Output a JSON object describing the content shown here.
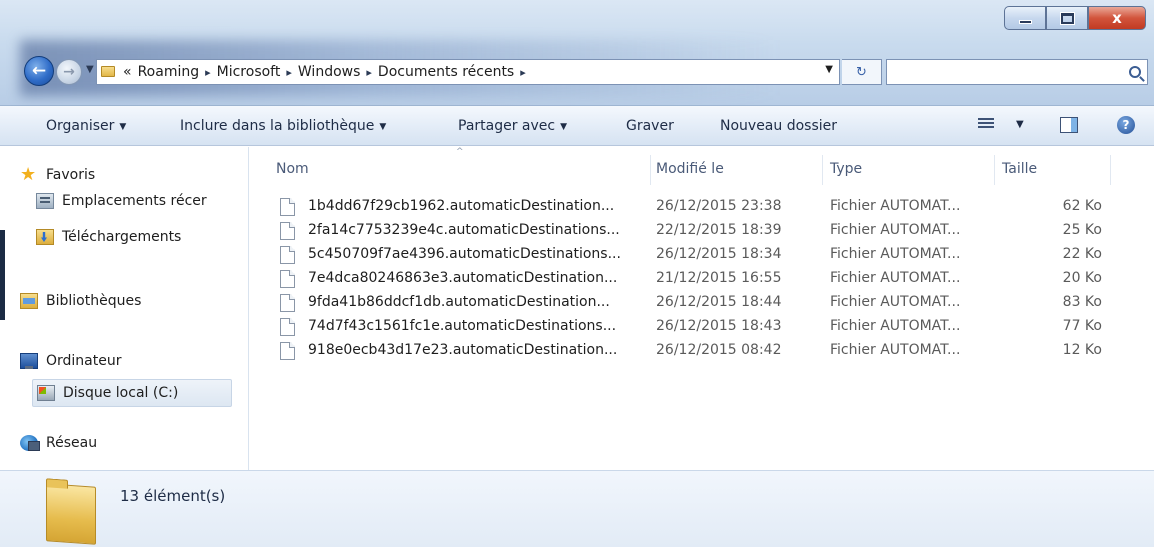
{
  "window": {
    "minimize_glyph": "",
    "close_glyph": "x"
  },
  "nav": {
    "back_glyph": "←",
    "forward_glyph": "→",
    "history_glyph": "▼"
  },
  "address": {
    "prefix": "«",
    "crumbs": [
      "Roaming",
      "Microsoft",
      "Windows",
      "Documents récents"
    ],
    "sep": "▸",
    "dropdown_glyph": "▼",
    "refresh_glyph": "↻"
  },
  "search": {
    "placeholder": ""
  },
  "toolbar": {
    "organiser": "Organiser",
    "inclure": "Inclure dans la bibliothèque",
    "partager": "Partager avec",
    "graver": "Graver",
    "nouveau": "Nouveau dossier",
    "caret": "▼",
    "help": "?"
  },
  "sidebar": {
    "favoris": "Favoris",
    "emplacements": "Emplacements récer",
    "telechargements": "Téléchargements",
    "bibliotheques": "Bibliothèques",
    "ordinateur": "Ordinateur",
    "disque": "Disque local (C:)",
    "reseau": "Réseau"
  },
  "columns": {
    "nom": "Nom",
    "modifie": "Modifié le",
    "type": "Type",
    "taille": "Taille",
    "sort_glyph": "^"
  },
  "files": [
    {
      "name": "1b4dd67f29cb1962.automaticDestination...",
      "date": "26/12/2015 23:38",
      "type": "Fichier AUTOMAT...",
      "size": "62 Ko"
    },
    {
      "name": "2fa14c7753239e4c.automaticDestinations...",
      "date": "22/12/2015 18:39",
      "type": "Fichier AUTOMAT...",
      "size": "25 Ko"
    },
    {
      "name": "5c450709f7ae4396.automaticDestinations...",
      "date": "26/12/2015 18:34",
      "type": "Fichier AUTOMAT...",
      "size": "22 Ko"
    },
    {
      "name": "7e4dca80246863e3.automaticDestination...",
      "date": "21/12/2015 16:55",
      "type": "Fichier AUTOMAT...",
      "size": "20 Ko"
    },
    {
      "name": "9fda41b86ddcf1db.automaticDestination...",
      "date": "26/12/2015 18:44",
      "type": "Fichier AUTOMAT...",
      "size": "83 Ko"
    },
    {
      "name": "74d7f43c1561fc1e.automaticDestinations...",
      "date": "26/12/2015 18:43",
      "type": "Fichier AUTOMAT...",
      "size": "77 Ko"
    },
    {
      "name": "918e0ecb43d17e23.automaticDestination...",
      "date": "26/12/2015 08:42",
      "type": "Fichier AUTOMAT...",
      "size": "12 Ko"
    }
  ],
  "details": {
    "count": "13 élément(s)"
  },
  "colors": {
    "accent": "#2f6cc8",
    "close": "#c13a22",
    "folder": "#e6bc4d"
  }
}
